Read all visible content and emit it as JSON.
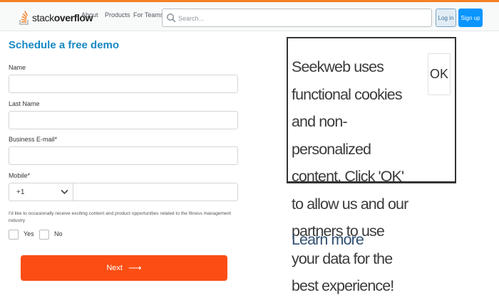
{
  "header": {
    "logo_brand_light": "stack",
    "logo_brand_bold": "overflow",
    "nav": {
      "about": "About",
      "products": "Products",
      "teams": "For Teams"
    },
    "search_placeholder": "Search...",
    "login_label": "Log in",
    "signup_label": "Sign up"
  },
  "form": {
    "title": "Schedule a free demo",
    "name_label": "Name",
    "last_name_label": "Last Name",
    "email_label": "Business E-mail*",
    "mobile_label": "Mobile*",
    "country_code": "+1",
    "consent_text": "I'd like to occasionally receive exciting content and product opportunities related to the fitness management industry",
    "yes_label": "Yes",
    "no_label": "No",
    "next_label": "Next",
    "next_arrow": "⟶"
  },
  "cookie": {
    "text": "Seekweb uses functional cookies and non-personalized content. Click 'OK' to allow us and our partners to use your data for the best experience!",
    "learn_more": "Learn more",
    "ok_label": "OK"
  },
  "colors": {
    "accent_orange": "#f48024",
    "title_blue": "#1788c4",
    "next_button": "#fb4d14",
    "signup_button": "#0a95ff"
  },
  "icons": [
    "stackoverflow-logo-icon",
    "search-icon",
    "chevron-down-icon",
    "arrow-right-icon"
  ]
}
